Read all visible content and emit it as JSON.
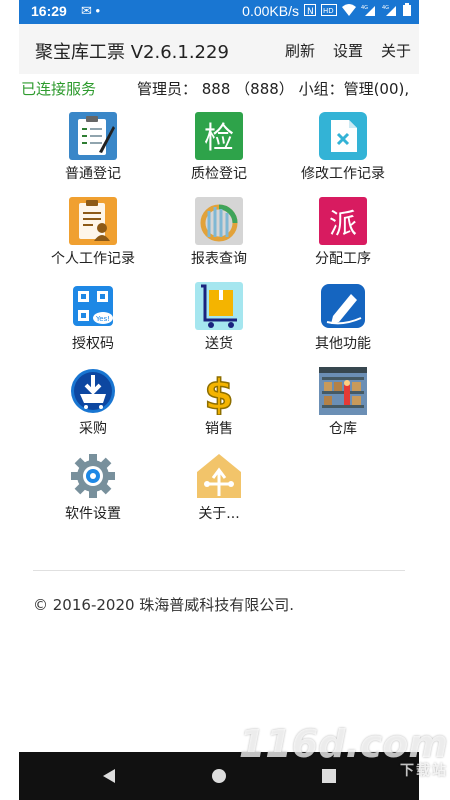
{
  "statusbar": {
    "time": "16:29",
    "notif": "✉ •",
    "speed": "0.00KB/s",
    "net1": "4G",
    "net2": "4G"
  },
  "toolbar": {
    "title": "聚宝库工票 V2.6.1.229",
    "refresh": "刷新",
    "settings": "设置",
    "about": "关于"
  },
  "info": {
    "connection": "已连接服务",
    "admin": "管理员：   888 （888） 小组：管理(00),"
  },
  "grid": [
    {
      "label": "普通登记",
      "icon": "clipboard-icon",
      "color": "#3a87c8"
    },
    {
      "label": "质检登记",
      "icon": "inspect-icon",
      "color": "#2ea34a"
    },
    {
      "label": "修改工作记录",
      "icon": "edit-record-icon",
      "color": "#33b3d6"
    },
    {
      "label": "个人工作记录",
      "icon": "person-record-icon",
      "color": "#f0a030"
    },
    {
      "label": "报表查询",
      "icon": "report-icon",
      "color": "#c8c8c8"
    },
    {
      "label": "分配工序",
      "icon": "dispatch-icon",
      "color": "#d81b60"
    },
    {
      "label": "授权码",
      "icon": "qrcode-icon",
      "color": "#1e88e5"
    },
    {
      "label": "送货",
      "icon": "cart-box-icon",
      "color": "#a5e6ef"
    },
    {
      "label": "其他功能",
      "icon": "pen-icon",
      "color": "#1565c0"
    },
    {
      "label": "采购",
      "icon": "shopping-cart-icon",
      "color": "#1976d2"
    },
    {
      "label": "销售",
      "icon": "dollar-icon",
      "color": "#f4b400"
    },
    {
      "label": "仓库",
      "icon": "warehouse-icon",
      "color": "#5d8ab8"
    },
    {
      "label": "软件设置",
      "icon": "gear-icon",
      "color": "#78909c"
    },
    {
      "label": "关于...",
      "icon": "about-icon",
      "color": "#f2c46a"
    }
  ],
  "footer": {
    "copyright": "© 2016-2020 珠海普威科技有限公司."
  },
  "watermark": {
    "logo": "116d.com",
    "sub": "下载站"
  }
}
